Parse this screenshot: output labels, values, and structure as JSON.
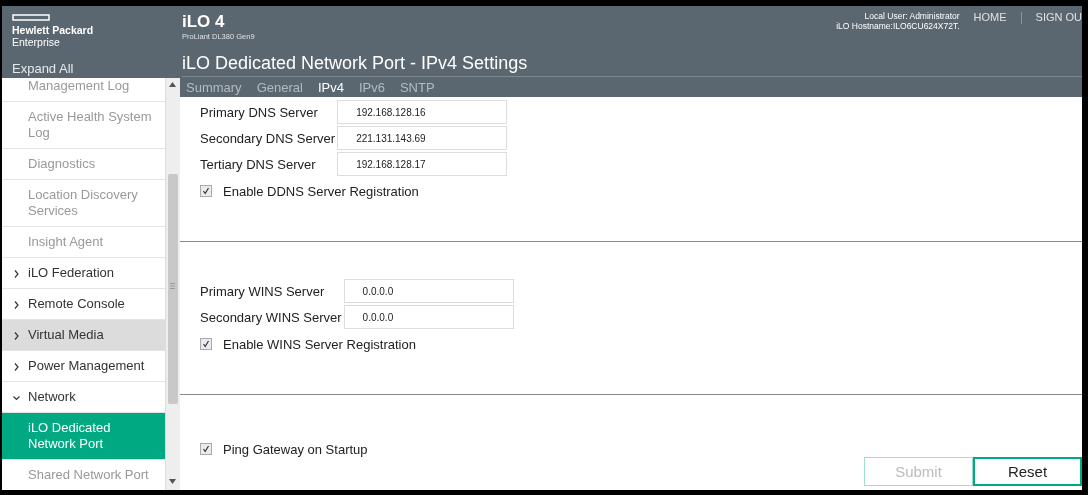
{
  "header": {
    "brand_line1": "Hewlett Packard",
    "brand_line2": "Enterprise",
    "product": "iLO 4",
    "server": "ProLiant DL380 Gen9",
    "local_user": "Local User:  Administrator",
    "hostname": "iLO Hostname:ILO6CU624X72T.",
    "links": [
      "HOME",
      "SIGN OU"
    ]
  },
  "sidebar": {
    "expand_all": "Expand All",
    "items": [
      {
        "kind": "leaf",
        "label": "Management Log",
        "selected": false,
        "highlighted": false
      },
      {
        "kind": "leaf",
        "label": "Active Health System Log",
        "selected": false,
        "highlighted": false
      },
      {
        "kind": "leaf",
        "label": "Diagnostics",
        "selected": false,
        "highlighted": false
      },
      {
        "kind": "leaf",
        "label": "Location Discovery Services",
        "selected": false,
        "highlighted": false
      },
      {
        "kind": "leaf",
        "label": "Insight Agent",
        "selected": false,
        "highlighted": false
      },
      {
        "kind": "group",
        "label": "iLO Federation",
        "expanded": false,
        "highlighted": false
      },
      {
        "kind": "group",
        "label": "Remote Console",
        "expanded": false,
        "highlighted": false
      },
      {
        "kind": "group",
        "label": "Virtual Media",
        "expanded": false,
        "highlighted": true
      },
      {
        "kind": "group",
        "label": "Power Management",
        "expanded": false,
        "highlighted": false
      },
      {
        "kind": "group",
        "label": "Network",
        "expanded": true,
        "highlighted": false
      },
      {
        "kind": "leaf",
        "label": "iLO Dedicated Network Port",
        "selected": true,
        "highlighted": false
      },
      {
        "kind": "leaf",
        "label": "Shared Network Port",
        "selected": false,
        "highlighted": false
      }
    ]
  },
  "page_title": "iLO Dedicated Network Port - IPv4 Settings",
  "tabs": [
    {
      "label": "Summary",
      "selected": false
    },
    {
      "label": "General",
      "selected": false
    },
    {
      "label": "IPv4",
      "selected": true
    },
    {
      "label": "IPv6",
      "selected": false
    },
    {
      "label": "SNTP",
      "selected": false
    }
  ],
  "sections": [
    {
      "fields": [
        {
          "label": "Primary DNS Server",
          "value": "192.168.128.16"
        },
        {
          "label": "Secondary DNS Server",
          "value": "221.131.143.69"
        },
        {
          "label": "Tertiary DNS Server",
          "value": "192.168.128.17"
        }
      ],
      "checkboxes": [
        {
          "label": "Enable DDNS Server Registration",
          "checked": true
        }
      ]
    },
    {
      "fields": [
        {
          "label": "Primary WINS Server",
          "value": "0.0.0.0"
        },
        {
          "label": "Secondary WINS Server",
          "value": "0.0.0.0"
        }
      ],
      "checkboxes": [
        {
          "label": "Enable WINS Server Registration",
          "checked": true
        }
      ]
    },
    {
      "checkboxes": [
        {
          "label": "Ping Gateway on Startup",
          "checked": true
        }
      ]
    }
  ],
  "buttons": [
    {
      "label": "Submit",
      "disabled": true
    },
    {
      "label": "Reset",
      "disabled": false
    }
  ]
}
